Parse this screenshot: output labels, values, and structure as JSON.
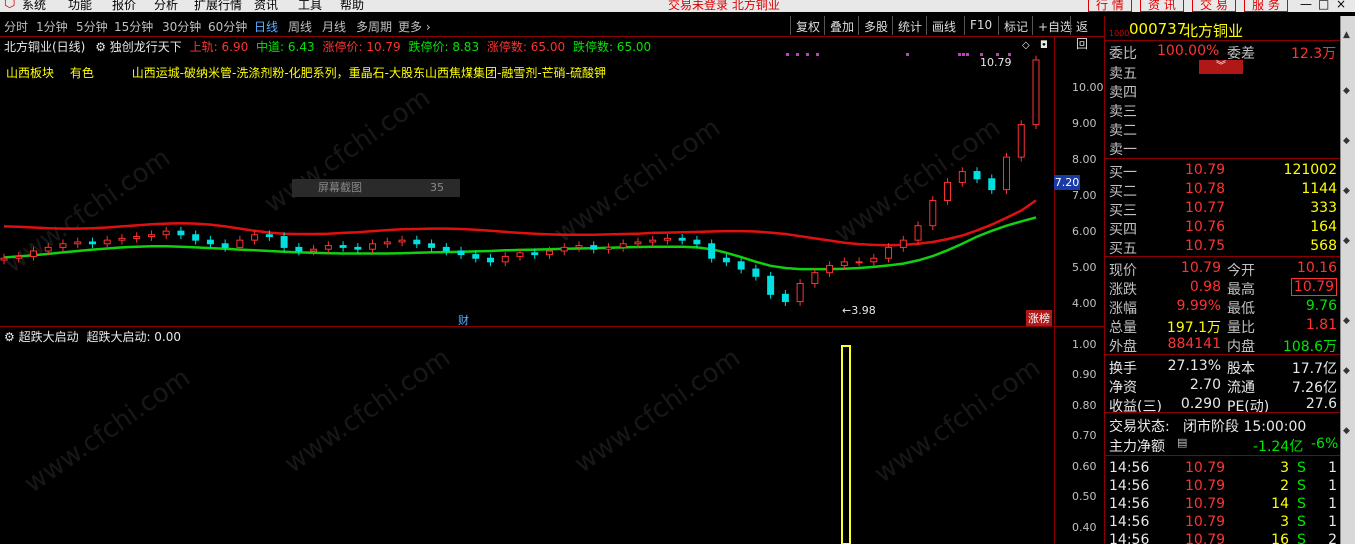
{
  "menubar": {
    "items": [
      "系统",
      "功能",
      "报价",
      "分析",
      "扩展行情",
      "资讯",
      "工具",
      "帮助"
    ],
    "center_text": "交易未登录  北方铜业",
    "right_tabs": [
      "行 情",
      "资 讯",
      "交 易",
      "服 务"
    ],
    "window_controls": [
      "—",
      "□",
      "×"
    ]
  },
  "periodbar": {
    "periods": [
      "分时",
      "1分钟",
      "5分钟",
      "15分钟",
      "30分钟",
      "60分钟",
      "日线",
      "周线",
      "月线",
      "多周期",
      "更多 ›"
    ],
    "active": "日线",
    "tools": [
      "复权",
      "叠加",
      "多股",
      "统计",
      "画线",
      "F10",
      "标记",
      "+自选",
      "返回"
    ]
  },
  "main_chart": {
    "legend_title": "北方铜业(日线)",
    "indicator_name": "独创龙行天下",
    "indicator_values": [
      {
        "label": "上轨: 6.90",
        "color": "#ff3232"
      },
      {
        "label": "中道: 6.43",
        "color": "#00e600"
      },
      {
        "label": "涨停价: 10.79",
        "color": "#ff3232"
      },
      {
        "label": "跌停价: 8.83",
        "color": "#00e600"
      },
      {
        "label": "涨停数: 65.00",
        "color": "#ff3232"
      },
      {
        "label": "跌停数: 65.00",
        "color": "#00e600"
      }
    ],
    "sector_label": "山西板块",
    "industry_label": "有色",
    "concept_text": "山西运城-破纳米管-洗涤剂粉-化肥系列，重晶石-大股东山西焦煤集团-融雪剂-芒硝-硫酸钾",
    "screenshot_tooltip": "屏幕截图",
    "tooltip_value": "35",
    "y_ticks": [
      "10.00",
      "9.00",
      "8.00",
      "7.00",
      "6.00",
      "5.00",
      "4.00"
    ],
    "price_marker": "7.20",
    "high_label": "10.79",
    "low_label": "←3.98",
    "caibao_marker": "财",
    "limit_up_marker": "涨榜"
  },
  "sub_chart": {
    "indicator_name": "超跌大启动",
    "indicator_value": "超跌大启动: 0.00",
    "y_ticks": [
      "1.00",
      "0.90",
      "0.80",
      "0.70",
      "0.60",
      "0.50",
      "0.40"
    ]
  },
  "panel": {
    "code": "000737",
    "name": "北方铜业",
    "webi_label": "委比",
    "webi_value": "100.00%",
    "weicha_label": "委差",
    "weicha_value": "12.3万",
    "asks": [
      {
        "label": "卖五",
        "price": "",
        "vol": ""
      },
      {
        "label": "卖四",
        "price": "",
        "vol": ""
      },
      {
        "label": "卖三",
        "price": "",
        "vol": ""
      },
      {
        "label": "卖二",
        "price": "",
        "vol": ""
      },
      {
        "label": "卖一",
        "price": "",
        "vol": ""
      }
    ],
    "bids": [
      {
        "label": "买一",
        "price": "10.79",
        "vol": "121002"
      },
      {
        "label": "买二",
        "price": "10.78",
        "vol": "1144"
      },
      {
        "label": "买三",
        "price": "10.77",
        "vol": "333"
      },
      {
        "label": "买四",
        "price": "10.76",
        "vol": "164"
      },
      {
        "label": "买五",
        "price": "10.75",
        "vol": "568"
      }
    ],
    "stats": [
      {
        "l1": "现价",
        "v1": "10.79",
        "c1": "red",
        "l2": "今开",
        "v2": "10.16",
        "c2": "red"
      },
      {
        "l1": "涨跌",
        "v1": "0.98",
        "c1": "red",
        "l2": "最高",
        "v2": "10.79",
        "c2": "red"
      },
      {
        "l1": "涨幅",
        "v1": "9.99%",
        "c1": "red",
        "l2": "最低",
        "v2": "9.76",
        "c2": "green"
      },
      {
        "l1": "总量",
        "v1": "197.1万",
        "c1": "yellow",
        "l2": "量比",
        "v2": "1.81",
        "c2": "red"
      },
      {
        "l1": "外盘",
        "v1": "884141",
        "c1": "red",
        "l2": "内盘",
        "v2": "108.6万",
        "c2": "green"
      }
    ],
    "stats2": [
      {
        "l1": "换手",
        "v1": "27.13%",
        "l2": "股本",
        "v2": "17.7亿"
      },
      {
        "l1": "净资",
        "v1": "2.70",
        "l2": "流通",
        "v2": "7.26亿"
      },
      {
        "l1": "收益(三)",
        "v1": "0.290",
        "l2": "PE(动)",
        "v2": "27.6"
      }
    ],
    "trade_status_label": "交易状态:",
    "trade_status_value": "闭市阶段 15:00:00",
    "main_flow_label": "主力净额",
    "main_flow_value": "-1.24亿",
    "main_flow_pct": "-6%",
    "ticks": [
      {
        "time": "14:56",
        "price": "10.79",
        "vol": "3",
        "side": "S",
        "n": "1"
      },
      {
        "time": "14:56",
        "price": "10.79",
        "vol": "2",
        "side": "S",
        "n": "1"
      },
      {
        "time": "14:56",
        "price": "10.79",
        "vol": "14",
        "side": "S",
        "n": "1"
      },
      {
        "time": "14:56",
        "price": "10.79",
        "vol": "3",
        "side": "S",
        "n": "1"
      },
      {
        "time": "14:56",
        "price": "10.79",
        "vol": "16",
        "side": "S",
        "n": "2"
      }
    ]
  },
  "chart_data": {
    "type": "candlestick",
    "y_range": [
      3.7,
      10.9
    ],
    "sub_y_range": [
      0.35,
      1.0
    ],
    "upper_band": [
      6.18,
      6.17,
      6.15,
      6.13,
      6.12,
      6.12,
      6.13,
      6.15,
      6.18,
      6.21,
      6.24,
      6.26,
      6.27,
      6.26,
      6.23,
      6.18,
      6.12,
      6.06,
      6.01,
      5.98,
      5.97,
      5.97,
      5.98,
      6.0,
      6.02,
      6.05,
      6.08,
      6.1,
      6.11,
      6.12,
      6.12,
      6.11,
      6.09,
      6.06,
      6.03,
      6.0,
      5.98,
      5.96,
      5.95,
      5.95,
      5.95,
      5.96,
      5.97,
      5.98,
      6.0,
      6.01,
      6.02,
      6.03,
      6.04,
      6.05,
      6.05,
      6.04,
      6.01,
      5.97,
      5.91,
      5.85,
      5.79,
      5.73,
      5.69,
      5.67,
      5.66,
      5.67,
      5.7,
      5.75,
      5.83,
      5.93,
      6.07,
      6.23,
      6.42,
      6.62,
      6.9
    ],
    "mid_band": [
      5.32,
      5.35,
      5.38,
      5.42,
      5.46,
      5.5,
      5.54,
      5.57,
      5.6,
      5.62,
      5.63,
      5.63,
      5.62,
      5.6,
      5.58,
      5.56,
      5.54,
      5.52,
      5.5,
      5.48,
      5.46,
      5.45,
      5.44,
      5.43,
      5.43,
      5.43,
      5.43,
      5.44,
      5.45,
      5.46,
      5.47,
      5.48,
      5.49,
      5.5,
      5.52,
      5.53,
      5.54,
      5.55,
      5.56,
      5.57,
      5.58,
      5.59,
      5.6,
      5.61,
      5.62,
      5.62,
      5.62,
      5.6,
      5.55,
      5.45,
      5.33,
      5.2,
      5.09,
      5.03,
      5.0,
      5.0,
      5.0,
      5.01,
      5.03,
      5.06,
      5.1,
      5.15,
      5.24,
      5.36,
      5.52,
      5.7,
      5.9,
      6.06,
      6.2,
      6.32,
      6.43
    ],
    "candles_close": [
      5.3,
      5.35,
      5.5,
      5.6,
      5.7,
      5.75,
      5.7,
      5.8,
      5.85,
      5.9,
      5.95,
      6.05,
      5.95,
      5.8,
      5.7,
      5.6,
      5.8,
      5.95,
      5.9,
      5.6,
      5.5,
      5.55,
      5.65,
      5.6,
      5.55,
      5.7,
      5.75,
      5.8,
      5.7,
      5.6,
      5.5,
      5.4,
      5.3,
      5.2,
      5.35,
      5.45,
      5.4,
      5.5,
      5.6,
      5.65,
      5.55,
      5.6,
      5.7,
      5.75,
      5.8,
      5.85,
      5.8,
      5.7,
      5.3,
      5.2,
      5.0,
      4.8,
      4.3,
      4.1,
      4.6,
      4.9,
      5.1,
      5.2,
      5.2,
      5.3,
      5.6,
      5.8,
      6.2,
      6.9,
      7.4,
      7.7,
      7.5,
      7.2,
      8.1,
      9.0,
      10.79
    ],
    "sub_signal": {
      "index": 54,
      "value": 1.0
    }
  }
}
